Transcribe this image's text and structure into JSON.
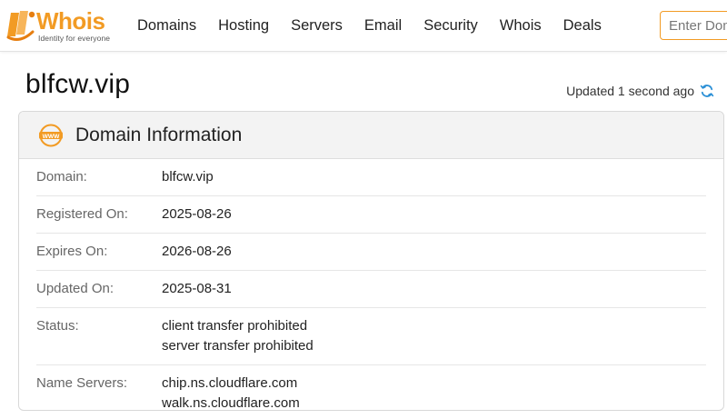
{
  "brand": {
    "logo_text": "Whois",
    "tagline": "Identity for everyone",
    "accent_color": "#f29b24"
  },
  "nav": {
    "items": [
      {
        "label": "Domains",
        "name": "nav-domains"
      },
      {
        "label": "Hosting",
        "name": "nav-hosting"
      },
      {
        "label": "Servers",
        "name": "nav-servers"
      },
      {
        "label": "Email",
        "name": "nav-email"
      },
      {
        "label": "Security",
        "name": "nav-security"
      },
      {
        "label": "Whois",
        "name": "nav-whois"
      },
      {
        "label": "Deals",
        "name": "nav-deals"
      }
    ]
  },
  "search": {
    "placeholder": "Enter Domain"
  },
  "page": {
    "domain": "blfcw.vip",
    "updated": "Updated 1 second ago",
    "refresh_icon": "refresh-icon"
  },
  "card": {
    "icon": "www-icon",
    "title": "Domain Information",
    "rows": [
      {
        "label": "Domain:",
        "values": [
          "blfcw.vip"
        ]
      },
      {
        "label": "Registered On:",
        "values": [
          "2025-08-26"
        ]
      },
      {
        "label": "Expires On:",
        "values": [
          "2026-08-26"
        ]
      },
      {
        "label": "Updated On:",
        "values": [
          "2025-08-31"
        ]
      },
      {
        "label": "Status:",
        "values": [
          "client transfer prohibited",
          "server transfer prohibited"
        ]
      },
      {
        "label": "Name Servers:",
        "values": [
          "chip.ns.cloudflare.com",
          "walk.ns.cloudflare.com"
        ]
      }
    ]
  }
}
